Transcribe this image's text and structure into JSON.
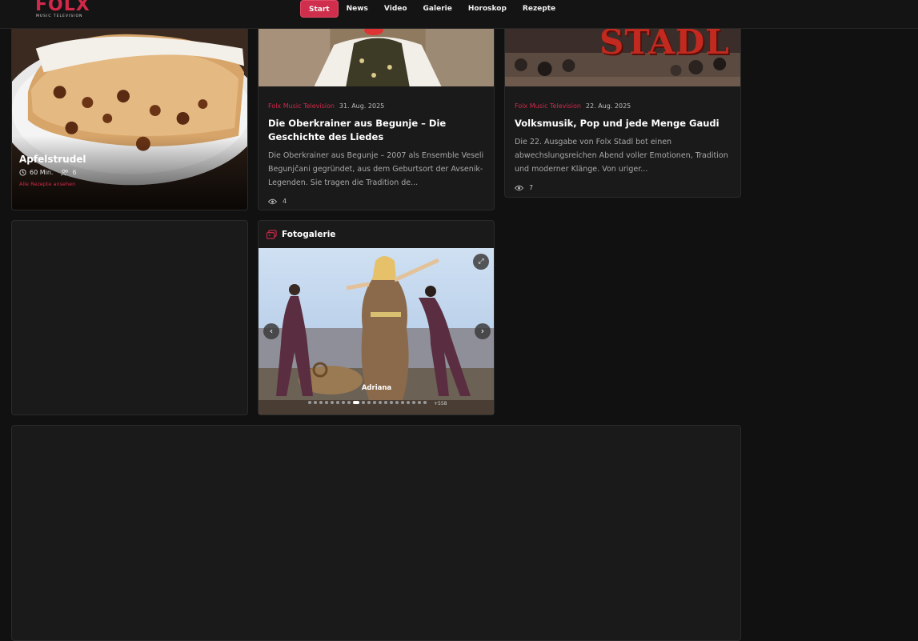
{
  "header": {
    "logo_text": "FOLX",
    "logo_subtitle": "MUSIC TELEVISION",
    "nav": [
      {
        "label": "Start",
        "active": true
      },
      {
        "label": "News"
      },
      {
        "label": "Video"
      },
      {
        "label": "Galerie"
      },
      {
        "label": "Horoskop"
      },
      {
        "label": "Rezepte"
      }
    ]
  },
  "recipe": {
    "title": "Apfelstrudel",
    "time": "60 Min.",
    "servings": "6",
    "link": "Alle Rezepte ansehen"
  },
  "articles": [
    {
      "source": "Folx Music Television",
      "date": "31. Aug. 2025",
      "title": "Die Oberkrainer aus Begunje – Die Geschichte des Liedes",
      "excerpt": "Die Oberkrainer aus Begunje – 2007 als Ensemble Veseli Begunjčani gegründet, aus dem Geburtsort der Avsenik-Legenden. Sie tragen die Tradition de...",
      "views": "4"
    },
    {
      "source": "Folx Music Television",
      "date": "22. Aug. 2025",
      "title": "Volksmusik, Pop und jede Menge Gaudi",
      "excerpt": "Die 22. Ausgabe von Folx Stadl bot einen abwechslungsreichen Abend voller Emotionen, Tradition und moderner Klänge. Von uriger...",
      "views": "7",
      "image_text": "STADL"
    }
  ],
  "gallery": {
    "title": "Fotogalerie",
    "caption": "Adriana",
    "more": "+558"
  },
  "colors": {
    "accent": "#d2284a",
    "bg": "#111111",
    "card": "#1a1a1a"
  },
  "icons": [
    "clock-icon",
    "people-icon",
    "eye-icon",
    "gallery-icon",
    "expand-icon",
    "chevron-left-icon",
    "chevron-right-icon"
  ]
}
